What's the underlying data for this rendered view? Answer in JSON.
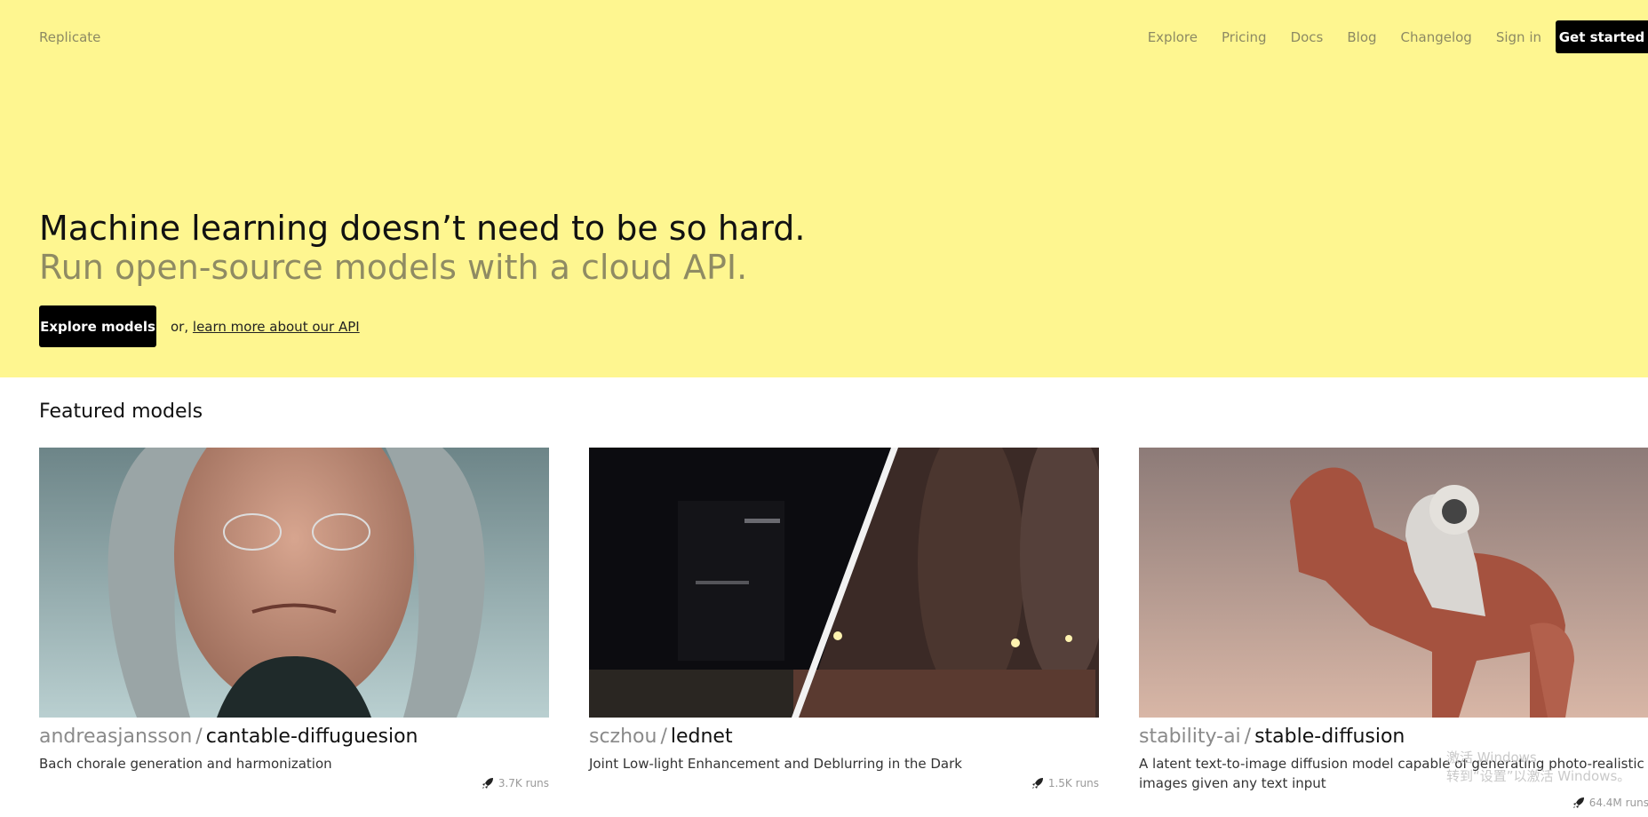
{
  "header": {
    "brand": "Replicate",
    "nav": [
      "Explore",
      "Pricing",
      "Docs",
      "Blog",
      "Changelog",
      "Sign in"
    ],
    "cta": "Get started"
  },
  "hero": {
    "headline": "Machine learning doesn’t need to be so hard.",
    "subheadline": "Run open-source models with a cloud API.",
    "explore_button": "Explore models",
    "api_prefix": "or,",
    "api_link": "learn more about our API"
  },
  "featured": {
    "title": "Featured models",
    "models": [
      {
        "owner": "andreasjansson",
        "name": "cantable-diffuguesion",
        "description": "Bach chorale generation and harmonization",
        "runs": "3.7K runs",
        "icon": "rocket-icon"
      },
      {
        "owner": "sczhou",
        "name": "lednet",
        "description": "Joint Low-light Enhancement and Deblurring in the Dark",
        "runs": "1.5K runs",
        "icon": "rocket-icon"
      },
      {
        "owner": "stability-ai",
        "name": "stable-diffusion",
        "description": "A latent text-to-image diffusion model capable of generating photo-realistic images given any text input",
        "runs": "64.4M runs",
        "icon": "rocket-icon"
      }
    ]
  },
  "watermark": {
    "line1": "激活 Windows",
    "line2": "转到“设置”以激活 Windows。"
  },
  "colors": {
    "hero_bg": "#fef690",
    "muted_text": "#8d8a63",
    "button_bg": "#000000"
  }
}
